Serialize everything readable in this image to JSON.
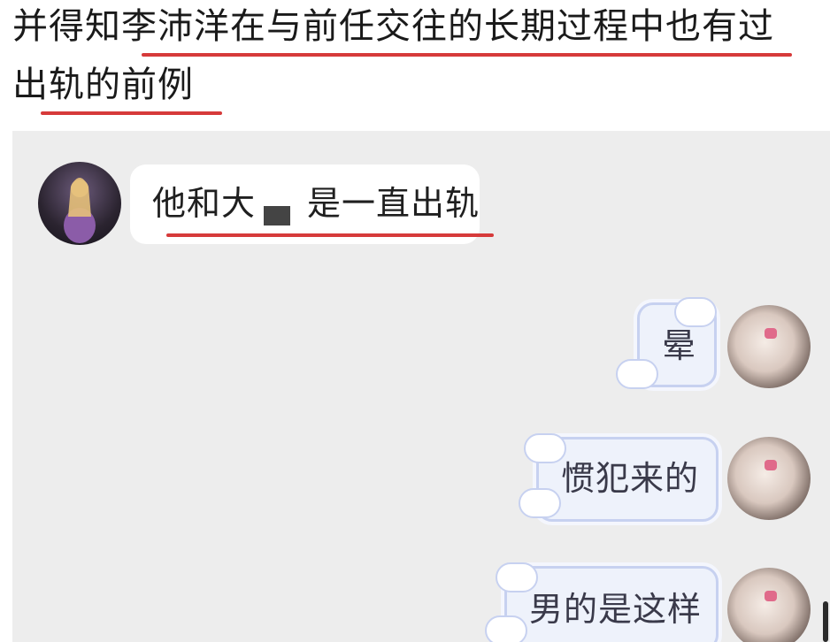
{
  "caption": {
    "line1": "并得知李沛洋在与前任交往的长期过程中也有过",
    "line2": "出轨的前例"
  },
  "messages": [
    {
      "side": "left",
      "text": "他和大",
      "text_after": "是一直出轨"
    },
    {
      "side": "right",
      "text": "晕"
    },
    {
      "side": "right",
      "text": "惯犯来的"
    },
    {
      "side": "right",
      "text": "男的是这样"
    }
  ],
  "colors": {
    "underline": "#d63a3a",
    "chat_bg": "#ededed",
    "bubble_left": "#ffffff",
    "bubble_right": "#eef2fb",
    "bubble_right_border": "#c7d1f0"
  }
}
